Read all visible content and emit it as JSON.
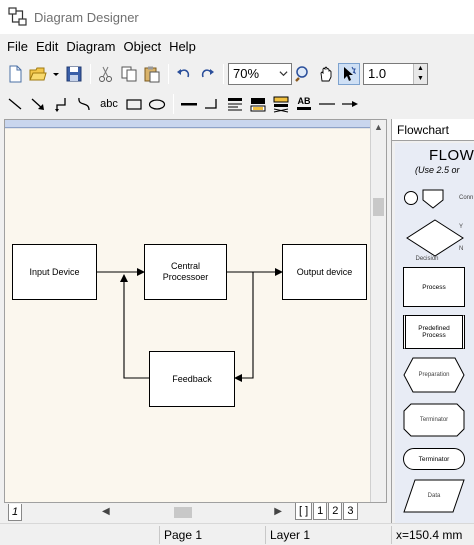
{
  "window": {
    "title": "Diagram Designer"
  },
  "menu": [
    "File",
    "Edit",
    "Diagram",
    "Object",
    "Help"
  ],
  "toolbar": {
    "zoom_value": "70%",
    "line_width_value": "1.0",
    "text_tool_label": "abc",
    "font_style_label": "AB"
  },
  "icons": {
    "new": "new-file-icon",
    "open": "open-folder-icon",
    "save": "save-disk-icon",
    "cut": "scissors-icon",
    "copy": "copy-icon",
    "paste": "paste-icon",
    "undo": "undo-icon",
    "redo": "redo-icon",
    "zoom": "magnifier-icon",
    "pan": "hand-icon",
    "select": "select-arrow-icon"
  },
  "diagram": {
    "input_label": "Input Device",
    "cpu_label": "Central\nProcessoer",
    "output_label": "Output device",
    "feedback_label": "Feedback"
  },
  "page_tabs": [
    "1",
    "[ ]",
    "1",
    "2",
    "3"
  ],
  "status": {
    "page": "Page 1",
    "layer": "Layer 1",
    "coord": "x=150.4 mm"
  },
  "palette": {
    "tab_label": "Flowchart",
    "title": "FLOWC",
    "subtitle": "(Use 2.5 or",
    "side_labels": [
      "Conn",
      "Y",
      "N"
    ],
    "shapes": [
      "Decision",
      "Process",
      "Predefined\nProcess",
      "Preparation",
      "Terminator",
      "Terminator",
      "Data"
    ]
  }
}
